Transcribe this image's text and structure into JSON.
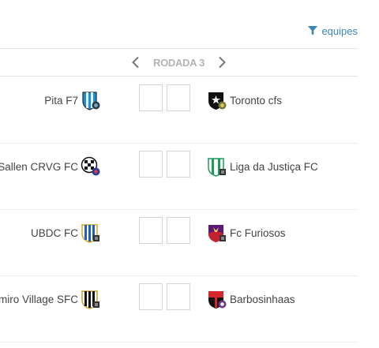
{
  "filter": {
    "label": "equipes",
    "icon": "filter-icon",
    "color": "#3a86b8"
  },
  "round": {
    "title": "RODADA 3",
    "prev_icon": "chevron-left-icon",
    "next_icon": "chevron-right-icon"
  },
  "matches": [
    {
      "home": {
        "name": "Pita F7",
        "crest": "pita-crest"
      },
      "home_score": "",
      "away_score": "",
      "away": {
        "name": "Toronto cfs",
        "crest": "toronto-crest"
      }
    },
    {
      "home": {
        "name": "Sallen CRVG FC",
        "crest": "sallen-crest"
      },
      "home_score": "",
      "away_score": "",
      "away": {
        "name": "Liga da Justiça FC",
        "crest": "liga-crest"
      }
    },
    {
      "home": {
        "name": "UBDC FC",
        "crest": "ubdc-crest"
      },
      "home_score": "",
      "away_score": "",
      "away": {
        "name": "Fc Furiosos",
        "crest": "furiosos-crest"
      }
    },
    {
      "home": {
        "name": "Belmiro Village SFC",
        "crest": "belmiro-crest"
      },
      "home_score": "",
      "away_score": "",
      "away": {
        "name": "Barbosinhaas",
        "crest": "barbosinhaas-crest"
      }
    }
  ]
}
